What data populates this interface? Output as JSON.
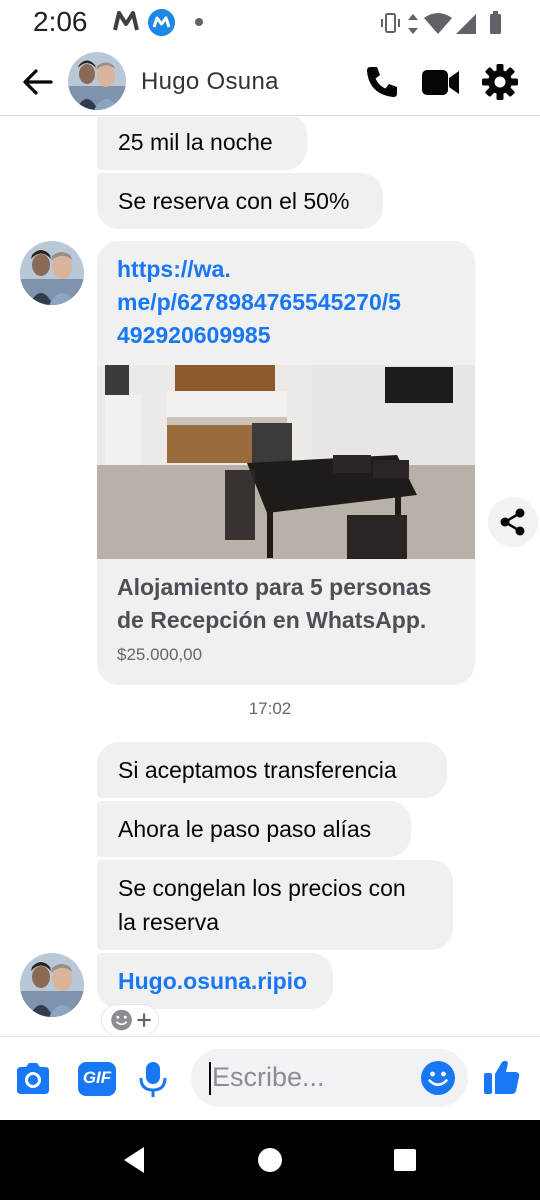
{
  "status_bar": {
    "time": "2:06",
    "carrier_icon": "m-logo-icon",
    "app_icon": "movistar-icon",
    "indicators": [
      "vibrate-icon",
      "data-arrows-icon",
      "wifi-icon",
      "signal-icon",
      "battery-icon"
    ]
  },
  "header": {
    "contact_name": "Hugo Osuna",
    "icons": [
      "back-arrow-icon",
      "phone-icon",
      "video-camera-icon",
      "gear-icon"
    ]
  },
  "messages": {
    "m1": "25 mil la noche",
    "m2": "Se reserva con el 50%",
    "link_card": {
      "url": "https://wa.me/p/6278984765545270/5492920609985",
      "url_line1": "https://wa.",
      "url_line2": "me/p/6278984765545270/5",
      "url_line3": "492920609985",
      "title_line1": "Alojamiento para 5 personas",
      "title_line2": "de Recepción en WhatsApp.",
      "price": "$25.000,00"
    },
    "timestamp": "17:02",
    "m3": "Si aceptamos transferencia",
    "m4": "Ahora le paso paso alías",
    "m5_line1": "Se congelan los precios con",
    "m5_line2": "la reserva",
    "m6": "Hugo.osuna.ripio"
  },
  "composer": {
    "placeholder": "Escribe...",
    "gif_label": "GIF",
    "icons": [
      "camera-icon",
      "gif-icon",
      "microphone-icon",
      "emoji-icon",
      "thumbs-up-icon"
    ]
  },
  "colors": {
    "accent": "#1877f2",
    "bubble": "#f0f0f0",
    "header_border": "#dadde1"
  }
}
